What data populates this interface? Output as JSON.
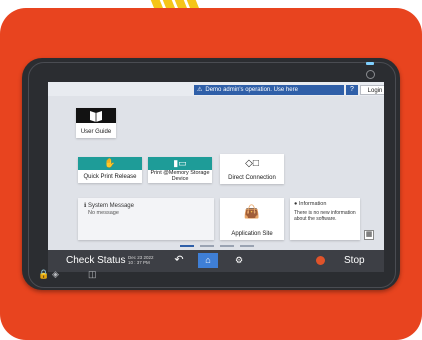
{
  "colors": {
    "card": "#e8441f",
    "stripe": "#f5c518",
    "device": "#2b2d31",
    "teal": "#1e9c98",
    "blue": "#2f5fa8"
  },
  "topbar": {
    "notice": "Demo admin's operation. Use here",
    "help": "?",
    "login": "Login",
    "sleep_icon": "moon-icon",
    "notice_icon": "warning-icon"
  },
  "tiles": {
    "user_guide": {
      "label": "User Guide",
      "icon": "book-icon"
    },
    "quick_print": {
      "label": "Quick Print Release",
      "icon": "hand-document-icon"
    },
    "memory_storage": {
      "label": "Print @Memory Storage Device",
      "icon": "usb-sd-icon"
    },
    "direct_connection": {
      "label": "Direct Connection",
      "icon": "direct-connect-icon"
    },
    "system_message": {
      "title": "System Message",
      "message": "No message"
    },
    "application_site": {
      "label": "Application Site",
      "icon": "shopping-bag-icon"
    },
    "information": {
      "title": "Information",
      "body": "There is no new information about the software."
    }
  },
  "bottombar": {
    "check_status": "Check Status",
    "date": "Dec 23 2022",
    "time": "10 : 37 PM",
    "stop": "Stop"
  },
  "pagination": {
    "pages": 4,
    "current": 1
  }
}
